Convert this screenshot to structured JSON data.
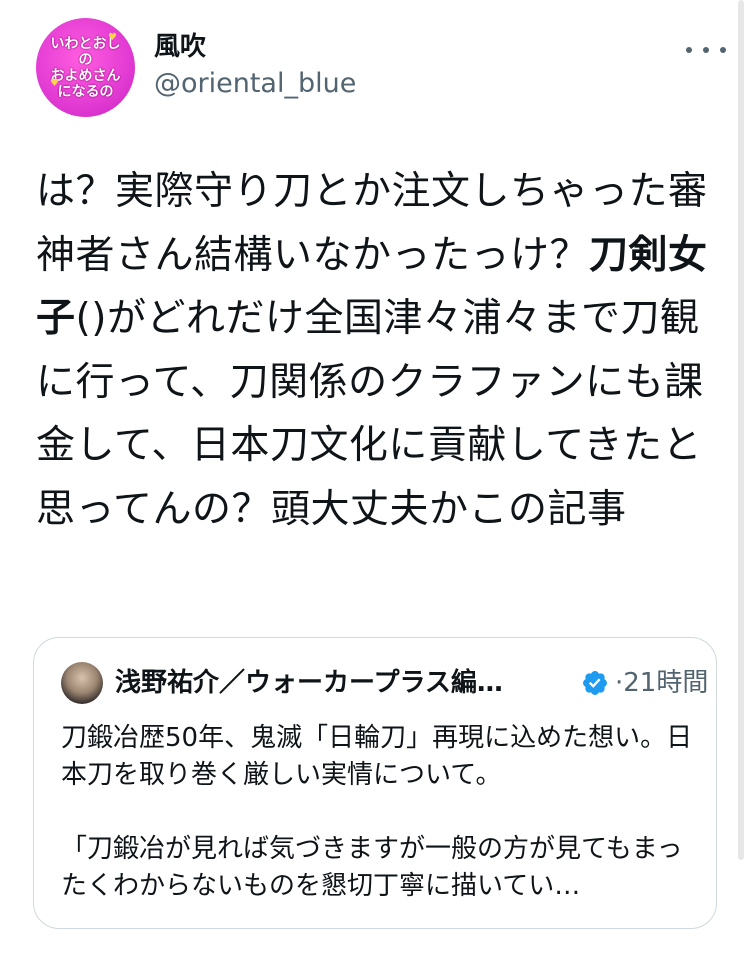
{
  "author": {
    "display_name": "風吹",
    "handle": "@oriental_blue",
    "avatar_text": "いわとおし\nの\nおよめさん\nになるの"
  },
  "tweet": {
    "text_part1": "は？実際守り刀とか注文しちゃった審神者さん結構いなかったっけ？",
    "text_bold": "刀剣女子",
    "text_part2": "()がどれだけ全国津々浦々まで刀観に行って、刀関係のクラファンにも課金して、日本刀文化に貢献してきたと思ってんの？頭大丈夫かこの記事"
  },
  "quote": {
    "author_name": "浅野祐介／ウォーカープラス編…",
    "verified_icon": "verified-badge",
    "separator": "·",
    "time": "21時間",
    "body": "刀鍛冶歴50年、鬼滅「日輪刀」再現に込めた想い。日本刀を取り巻く厳しい実情について。\n\n「刀鍛冶が見れば気づきますが一般の方が見てもまったくわからないものを懇切丁寧に描いてい…"
  },
  "colors": {
    "text": "#0f1419",
    "secondary": "#536471",
    "border": "#cfd9de",
    "verified": "#1d9bf0",
    "avatar_pink": "#e23bd3"
  },
  "icons": {
    "more": "more-horizontal-icon",
    "verified": "verified-badge-icon"
  }
}
